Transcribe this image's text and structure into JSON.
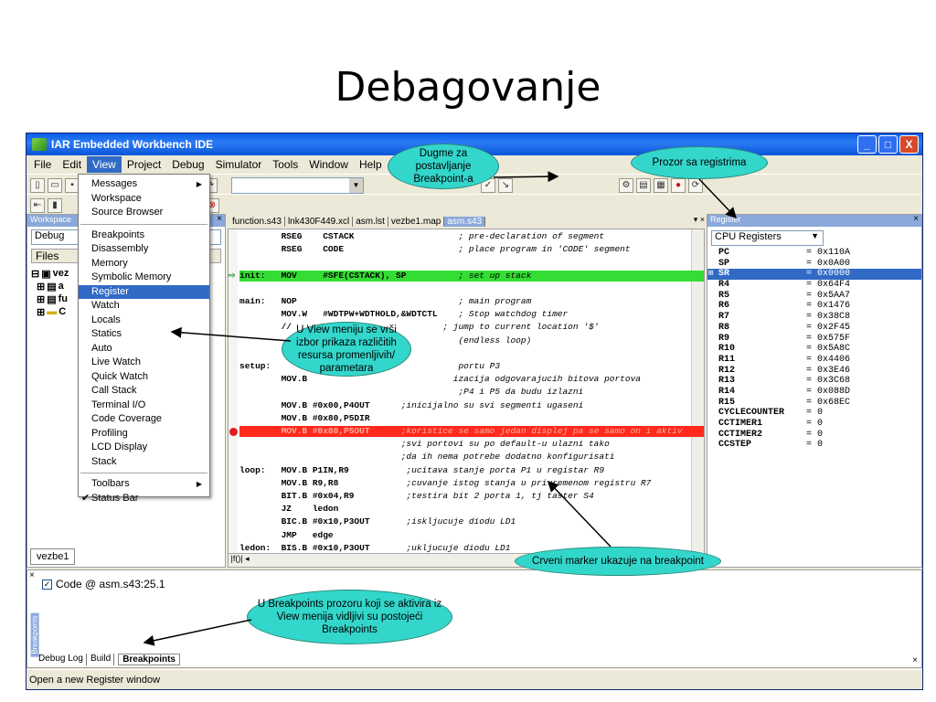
{
  "slide_title": "Debagovanje",
  "window": {
    "title": "IAR Embedded Workbench IDE",
    "buttons": [
      "_",
      "□",
      "X"
    ]
  },
  "menu": [
    "File",
    "Edit",
    "View",
    "Project",
    "Debug",
    "Simulator",
    "Tools",
    "Window",
    "Help"
  ],
  "view_menu": {
    "group1": [
      "Messages",
      "Workspace",
      "Source Browser"
    ],
    "group2": [
      "Breakpoints",
      "Disassembly",
      "Memory",
      "Symbolic Memory",
      "Register",
      "Watch",
      "Locals",
      "Statics",
      "Auto",
      "Live Watch",
      "Quick Watch",
      "Call Stack",
      "Terminal I/O",
      "Code Coverage",
      "Profiling",
      "LCD Display",
      "Stack"
    ],
    "group3": [
      "Toolbars",
      "Status Bar"
    ]
  },
  "workspace": {
    "header": "Workspace",
    "combo": "Debug",
    "files": "Files",
    "tree": [
      "vez",
      "a",
      "fu",
      "C"
    ],
    "tab": "vezbe1"
  },
  "editor": {
    "tabs": [
      "function.s43",
      "lnk430F449.xcl",
      "asm.lst",
      "vezbe1.map",
      "asm.s43"
    ],
    "lines": [
      {
        "t": "        RSEG    CSTACK                    ",
        "c": "; pre-declaration of segment"
      },
      {
        "t": "        RSEG    CODE                      ",
        "c": "; place program in 'CODE' segment"
      },
      {
        "t": "",
        "c": ""
      },
      {
        "t": "init:   MOV     #SFE(CSTACK), SP          ",
        "c": "; set up stack",
        "cls": "green",
        "pc": true
      },
      {
        "t": "",
        "c": ""
      },
      {
        "t": "main:   NOP                               ",
        "c": "; main program"
      },
      {
        "t": "        MOV.W   #WDTPW+WDTHOLD,&WDTCTL    ",
        "c": "; Stop watchdog timer"
      },
      {
        "t": "        //      ",
        "c": "                       ; jump to current location '$'"
      },
      {
        "t": "        ",
        "c": "                                  (endless loop)"
      },
      {
        "t": "",
        "c": ""
      },
      {
        "t": "setup:  ",
        "c": "                                  portu P3"
      },
      {
        "t": "        MOV.B   ",
        "c": "                         izacija odgovarajucih bitova portova"
      },
      {
        "t": "        ",
        "c": "                                  ;P4 i P5 da budu izlazni"
      },
      {
        "t": "        MOV.B #0x00,P4OUT      ",
        "c": ";inicijalno su svi segmenti ugaseni"
      },
      {
        "t": "        MOV.B #0x80,P5DIR",
        "c": ""
      },
      {
        "t": "        MOV.B #0x80,P5OUT      ",
        "c": ";koristice se samo jedan displej pa se samo on i aktiv",
        "cls": "red",
        "bp": true
      },
      {
        "t": "                               ",
        "c": ";svi portovi su po default-u ulazni tako"
      },
      {
        "t": "                               ",
        "c": ";da ih nema potrebe dodatno konfigurisati"
      },
      {
        "t": "loop:   MOV.B P1IN,R9           ",
        "c": ";ucitava stanje porta P1 u registar R9"
      },
      {
        "t": "        MOV.B R9,R8             ",
        "c": ";cuvanje istog stanja u privremenom registru R7"
      },
      {
        "t": "        BIT.B #0x04,R9          ",
        "c": ";testira bit 2 porta 1, tj taster S4"
      },
      {
        "t": "        JZ    ledon",
        "c": ""
      },
      {
        "t": "        BIC.B #0x10,P3OUT       ",
        "c": ";iskljucuje diodu LD1"
      },
      {
        "t": "        JMP   edge",
        "c": ""
      },
      {
        "t": "ledon:  BIS.B #0x10,P3OUT       ",
        "c": ";ukljucuje diodu LD1"
      }
    ]
  },
  "registers": {
    "header": "Register",
    "combo": "CPU Registers",
    "rows": [
      {
        "n": "PC",
        "v": "= 0x110A"
      },
      {
        "n": "SP",
        "v": "= 0x0A00"
      },
      {
        "n": "SR",
        "v": "= 0x0000",
        "sel": true,
        "plus": true
      },
      {
        "n": "R4",
        "v": "= 0x64F4"
      },
      {
        "n": "R5",
        "v": "= 0x5AA7"
      },
      {
        "n": "R6",
        "v": "= 0x1476"
      },
      {
        "n": "R7",
        "v": "= 0x38C8"
      },
      {
        "n": "R8",
        "v": "= 0x2F45"
      },
      {
        "n": "R9",
        "v": "= 0x575F"
      },
      {
        "n": "R10",
        "v": "= 0x5A8C"
      },
      {
        "n": "R11",
        "v": "= 0x4406"
      },
      {
        "n": "R12",
        "v": "= 0x3E46"
      },
      {
        "n": "R13",
        "v": "= 0x3C68"
      },
      {
        "n": "R14",
        "v": "= 0x088D"
      },
      {
        "n": "R15",
        "v": "= 0x68EC"
      },
      {
        "n": "CYCLECOUNTER",
        "v": "= 0"
      },
      {
        "n": "CCTIMER1",
        "v": "= 0"
      },
      {
        "n": "CCTIMER2",
        "v": "= 0"
      },
      {
        "n": "CCSTEP",
        "v": "= 0"
      }
    ]
  },
  "breakpoints": {
    "item": "Code @ asm.s43:25.1",
    "side_label": "Breakpoints",
    "tabs": [
      "Debug Log",
      "Build",
      "Breakpoints"
    ]
  },
  "status": "Open a new Register window",
  "callouts": {
    "dugme": "Dugme za postavljanje Breakpoint-a",
    "prozor": "Prozor sa registrima",
    "view": "U View meniju se vrši izbor prikaza različitih resursa promenljivih/ parametara",
    "crveni": "Crveni marker ukazuje na breakpoint",
    "bp": "U Breakpoints prozoru koji se aktivira iz View menija vidljivi su postojeći Breakpoints"
  },
  "colors": {
    "breakpoint_line": "#ff2a1c",
    "pc_line": "#33dd33",
    "callout": "#33d6cb",
    "selection": "#316ac5"
  }
}
